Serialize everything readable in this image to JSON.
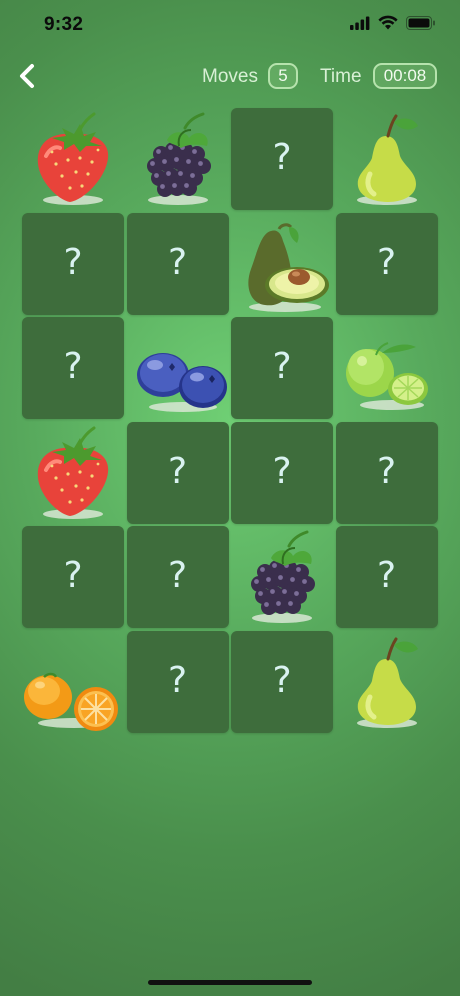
{
  "status": {
    "time": "9:32"
  },
  "header": {
    "moves_label": "Moves",
    "moves_value": "5",
    "time_label": "Time",
    "time_value": "00:08"
  },
  "board": {
    "columns": 4,
    "rows": 6,
    "hidden_symbol": "?",
    "cards": [
      {
        "state": "revealed",
        "fruit": "strawberry"
      },
      {
        "state": "revealed",
        "fruit": "blackberry"
      },
      {
        "state": "hidden"
      },
      {
        "state": "revealed",
        "fruit": "pear"
      },
      {
        "state": "hidden"
      },
      {
        "state": "hidden"
      },
      {
        "state": "revealed",
        "fruit": "avocado"
      },
      {
        "state": "hidden"
      },
      {
        "state": "hidden"
      },
      {
        "state": "revealed",
        "fruit": "blueberry"
      },
      {
        "state": "hidden"
      },
      {
        "state": "revealed",
        "fruit": "lime"
      },
      {
        "state": "revealed",
        "fruit": "strawberry"
      },
      {
        "state": "hidden"
      },
      {
        "state": "hidden"
      },
      {
        "state": "hidden"
      },
      {
        "state": "hidden"
      },
      {
        "state": "hidden"
      },
      {
        "state": "revealed",
        "fruit": "blackberry"
      },
      {
        "state": "hidden"
      },
      {
        "state": "revealed",
        "fruit": "orange"
      },
      {
        "state": "hidden"
      },
      {
        "state": "hidden"
      },
      {
        "state": "revealed",
        "fruit": "pear"
      }
    ]
  },
  "colors": {
    "card_back": "#3e6d3c",
    "question_mark": "#d9f2f0",
    "pill_border": "#b6e3ad"
  }
}
